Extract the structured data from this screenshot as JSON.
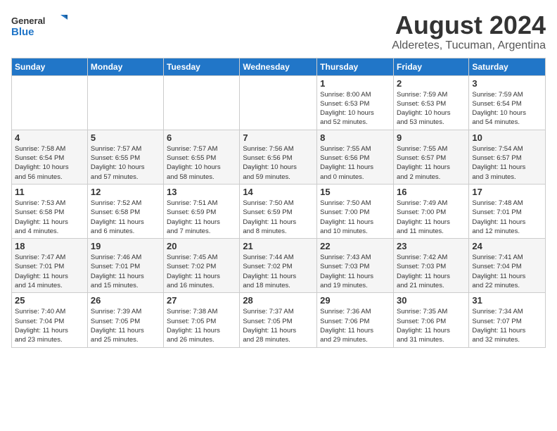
{
  "header": {
    "logo_general": "General",
    "logo_blue": "Blue",
    "main_title": "August 2024",
    "subtitle": "Alderetes, Tucuman, Argentina"
  },
  "weekdays": [
    "Sunday",
    "Monday",
    "Tuesday",
    "Wednesday",
    "Thursday",
    "Friday",
    "Saturday"
  ],
  "weeks": [
    [
      {
        "day": "",
        "info": ""
      },
      {
        "day": "",
        "info": ""
      },
      {
        "day": "",
        "info": ""
      },
      {
        "day": "",
        "info": ""
      },
      {
        "day": "1",
        "info": "Sunrise: 8:00 AM\nSunset: 6:53 PM\nDaylight: 10 hours\nand 52 minutes."
      },
      {
        "day": "2",
        "info": "Sunrise: 7:59 AM\nSunset: 6:53 PM\nDaylight: 10 hours\nand 53 minutes."
      },
      {
        "day": "3",
        "info": "Sunrise: 7:59 AM\nSunset: 6:54 PM\nDaylight: 10 hours\nand 54 minutes."
      }
    ],
    [
      {
        "day": "4",
        "info": "Sunrise: 7:58 AM\nSunset: 6:54 PM\nDaylight: 10 hours\nand 56 minutes."
      },
      {
        "day": "5",
        "info": "Sunrise: 7:57 AM\nSunset: 6:55 PM\nDaylight: 10 hours\nand 57 minutes."
      },
      {
        "day": "6",
        "info": "Sunrise: 7:57 AM\nSunset: 6:55 PM\nDaylight: 10 hours\nand 58 minutes."
      },
      {
        "day": "7",
        "info": "Sunrise: 7:56 AM\nSunset: 6:56 PM\nDaylight: 10 hours\nand 59 minutes."
      },
      {
        "day": "8",
        "info": "Sunrise: 7:55 AM\nSunset: 6:56 PM\nDaylight: 11 hours\nand 0 minutes."
      },
      {
        "day": "9",
        "info": "Sunrise: 7:55 AM\nSunset: 6:57 PM\nDaylight: 11 hours\nand 2 minutes."
      },
      {
        "day": "10",
        "info": "Sunrise: 7:54 AM\nSunset: 6:57 PM\nDaylight: 11 hours\nand 3 minutes."
      }
    ],
    [
      {
        "day": "11",
        "info": "Sunrise: 7:53 AM\nSunset: 6:58 PM\nDaylight: 11 hours\nand 4 minutes."
      },
      {
        "day": "12",
        "info": "Sunrise: 7:52 AM\nSunset: 6:58 PM\nDaylight: 11 hours\nand 6 minutes."
      },
      {
        "day": "13",
        "info": "Sunrise: 7:51 AM\nSunset: 6:59 PM\nDaylight: 11 hours\nand 7 minutes."
      },
      {
        "day": "14",
        "info": "Sunrise: 7:50 AM\nSunset: 6:59 PM\nDaylight: 11 hours\nand 8 minutes."
      },
      {
        "day": "15",
        "info": "Sunrise: 7:50 AM\nSunset: 7:00 PM\nDaylight: 11 hours\nand 10 minutes."
      },
      {
        "day": "16",
        "info": "Sunrise: 7:49 AM\nSunset: 7:00 PM\nDaylight: 11 hours\nand 11 minutes."
      },
      {
        "day": "17",
        "info": "Sunrise: 7:48 AM\nSunset: 7:01 PM\nDaylight: 11 hours\nand 12 minutes."
      }
    ],
    [
      {
        "day": "18",
        "info": "Sunrise: 7:47 AM\nSunset: 7:01 PM\nDaylight: 11 hours\nand 14 minutes."
      },
      {
        "day": "19",
        "info": "Sunrise: 7:46 AM\nSunset: 7:01 PM\nDaylight: 11 hours\nand 15 minutes."
      },
      {
        "day": "20",
        "info": "Sunrise: 7:45 AM\nSunset: 7:02 PM\nDaylight: 11 hours\nand 16 minutes."
      },
      {
        "day": "21",
        "info": "Sunrise: 7:44 AM\nSunset: 7:02 PM\nDaylight: 11 hours\nand 18 minutes."
      },
      {
        "day": "22",
        "info": "Sunrise: 7:43 AM\nSunset: 7:03 PM\nDaylight: 11 hours\nand 19 minutes."
      },
      {
        "day": "23",
        "info": "Sunrise: 7:42 AM\nSunset: 7:03 PM\nDaylight: 11 hours\nand 21 minutes."
      },
      {
        "day": "24",
        "info": "Sunrise: 7:41 AM\nSunset: 7:04 PM\nDaylight: 11 hours\nand 22 minutes."
      }
    ],
    [
      {
        "day": "25",
        "info": "Sunrise: 7:40 AM\nSunset: 7:04 PM\nDaylight: 11 hours\nand 23 minutes."
      },
      {
        "day": "26",
        "info": "Sunrise: 7:39 AM\nSunset: 7:05 PM\nDaylight: 11 hours\nand 25 minutes."
      },
      {
        "day": "27",
        "info": "Sunrise: 7:38 AM\nSunset: 7:05 PM\nDaylight: 11 hours\nand 26 minutes."
      },
      {
        "day": "28",
        "info": "Sunrise: 7:37 AM\nSunset: 7:05 PM\nDaylight: 11 hours\nand 28 minutes."
      },
      {
        "day": "29",
        "info": "Sunrise: 7:36 AM\nSunset: 7:06 PM\nDaylight: 11 hours\nand 29 minutes."
      },
      {
        "day": "30",
        "info": "Sunrise: 7:35 AM\nSunset: 7:06 PM\nDaylight: 11 hours\nand 31 minutes."
      },
      {
        "day": "31",
        "info": "Sunrise: 7:34 AM\nSunset: 7:07 PM\nDaylight: 11 hours\nand 32 minutes."
      }
    ]
  ]
}
